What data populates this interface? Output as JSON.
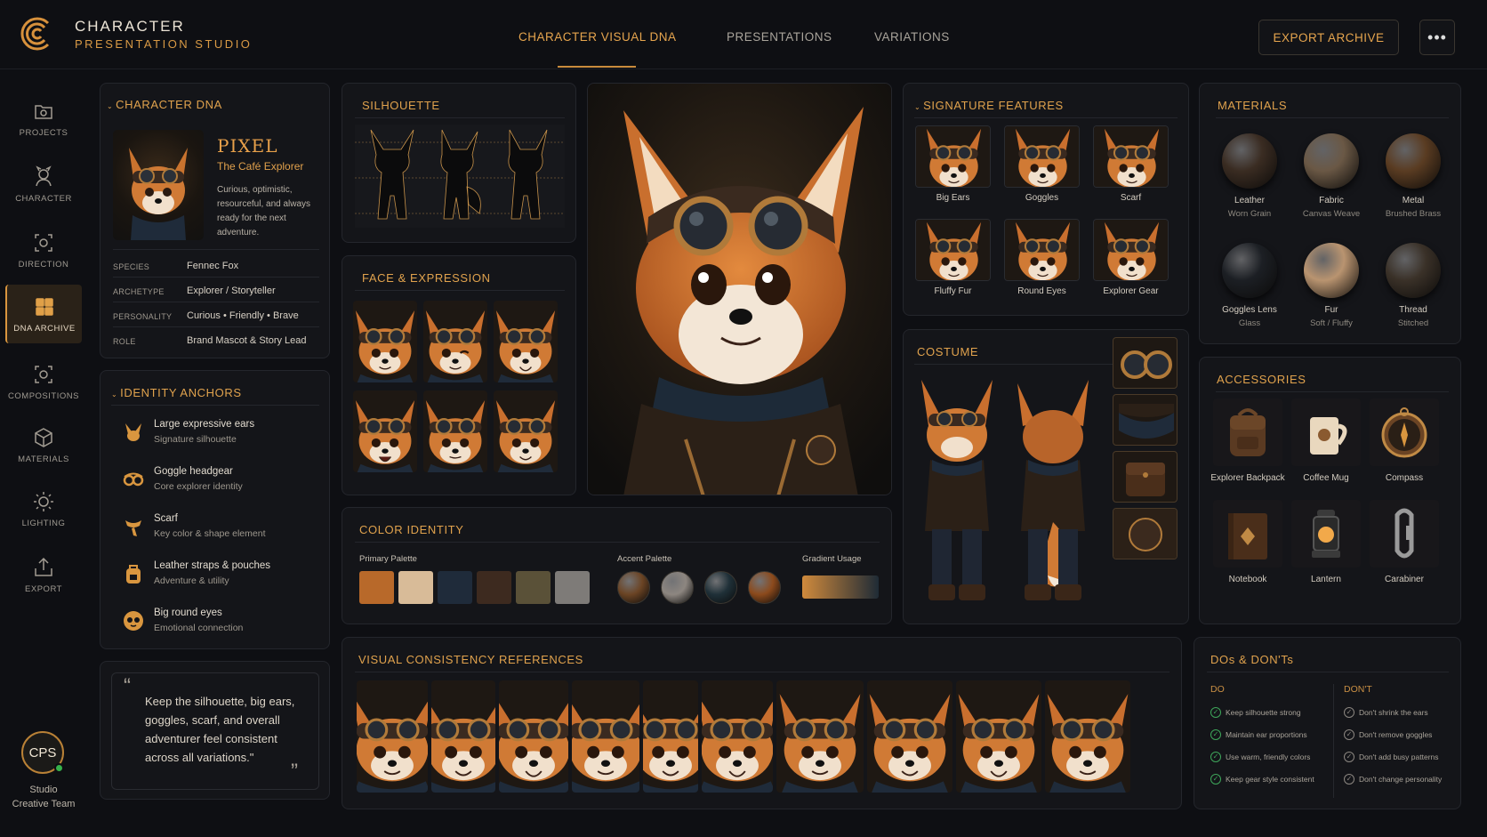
{
  "brand": {
    "line1": "CHARACTER",
    "line2": "PRESENTATION STUDIO"
  },
  "nav": {
    "tabs": [
      "CHARACTER VISUAL DNA",
      "PRESENTATIONS",
      "VARIATIONS"
    ],
    "active": 0
  },
  "header": {
    "export_label": "EXPORT ARCHIVE",
    "more_label": "•••"
  },
  "sidebar": {
    "items": [
      {
        "label": "PROJECTS",
        "icon": "folder-camera-icon"
      },
      {
        "label": "CHARACTER",
        "icon": "character-icon"
      },
      {
        "label": "DIRECTION",
        "icon": "direction-icon"
      },
      {
        "label": "DNA ARCHIVE",
        "icon": "archive-grid-icon",
        "active": true
      },
      {
        "label": "COMPOSITIONS",
        "icon": "compositions-icon"
      },
      {
        "label": "MATERIALS",
        "icon": "cube-icon"
      },
      {
        "label": "LIGHTING",
        "icon": "sun-icon"
      },
      {
        "label": "EXPORT",
        "icon": "export-icon"
      }
    ]
  },
  "user": {
    "initials": "CPS",
    "line1": "Studio",
    "line2": "Creative Team"
  },
  "dna": {
    "title": "CHARACTER DNA",
    "name": "PIXEL",
    "subtitle": "The Café Explorer",
    "description": "Curious, optimistic, resourceful, and always ready for the next adventure.",
    "attributes": [
      {
        "key": "SPECIES",
        "value": "Fennec Fox"
      },
      {
        "key": "ARCHETYPE",
        "value": "Explorer / Storyteller"
      },
      {
        "key": "PERSONALITY",
        "value": "Curious • Friendly • Brave"
      },
      {
        "key": "ROLE",
        "value": "Brand Mascot & Story Lead"
      }
    ]
  },
  "anchors": {
    "title": "IDENTITY ANCHORS",
    "items": [
      {
        "title": "Large expressive ears",
        "sub": "Signature silhouette",
        "icon": "ears-icon"
      },
      {
        "title": "Goggle headgear",
        "sub": "Core explorer identity",
        "icon": "goggles-icon"
      },
      {
        "title": "Scarf",
        "sub": "Key color & shape element",
        "icon": "scarf-icon"
      },
      {
        "title": "Leather straps & pouches",
        "sub": "Adventure & utility",
        "icon": "backpack-icon"
      },
      {
        "title": "Big round eyes",
        "sub": "Emotional connection",
        "icon": "eyes-icon"
      }
    ]
  },
  "quote": {
    "text": "Keep the silhouette, big ears, goggles, scarf, and overall adventurer feel consistent across all variations.\"",
    "open": "“",
    "close": "”"
  },
  "silhouette": {
    "title": "SILHOUETTE"
  },
  "face": {
    "title": "FACE & EXPRESSION"
  },
  "signature": {
    "title": "SIGNATURE FEATURES",
    "items": [
      "Big Ears",
      "Goggles",
      "Scarf",
      "Fluffy Fur",
      "Round Eyes",
      "Explorer Gear"
    ]
  },
  "materials": {
    "title": "MATERIALS",
    "items": [
      {
        "name": "Leather",
        "sub": "Worn Grain",
        "color": "#3a2c22"
      },
      {
        "name": "Fabric",
        "sub": "Canvas Weave",
        "color": "#6a5845"
      },
      {
        "name": "Metal",
        "sub": "Brushed Brass",
        "color": "#5a3c22"
      },
      {
        "name": "Goggles Lens",
        "sub": "Glass",
        "color": "#1c1f24"
      },
      {
        "name": "Fur",
        "sub": "Soft / Fluffy",
        "color": "#b99470"
      },
      {
        "name": "Thread",
        "sub": "Stitched",
        "color": "#3a3128"
      }
    ]
  },
  "costume": {
    "title": "COSTUME"
  },
  "accessories": {
    "title": "ACCESSORIES",
    "items": [
      "Explorer Backpack",
      "Coffee Mug",
      "Compass",
      "Notebook",
      "Lantern",
      "Carabiner"
    ]
  },
  "color": {
    "title": "COLOR IDENTITY",
    "primary_label": "Primary Palette",
    "accent_label": "Accent Palette",
    "gradient_label": "Gradient Usage",
    "primary": [
      "#b8692a",
      "#d8bb98",
      "#1f2b3a",
      "#3d2a1f",
      "#5a5138",
      "#7e7b78"
    ],
    "accent": [
      "#6b4424",
      "#8d8680",
      "#1f3038",
      "#8c4a1c"
    ],
    "gradient": [
      "#d08a3c",
      "#1f2b36"
    ]
  },
  "consistency": {
    "title": "VISUAL CONSISTENCY REFERENCES"
  },
  "dos": {
    "title": "DOs & DON'Ts",
    "do_label": "DO",
    "dont_label": "DON'T",
    "do": [
      "Keep silhouette strong",
      "Maintain ear proportions",
      "Use warm, friendly colors",
      "Keep gear style consistent"
    ],
    "dont": [
      "Don't shrink the ears",
      "Don't remove goggles",
      "Don't add busy patterns",
      "Don't change personality"
    ]
  }
}
